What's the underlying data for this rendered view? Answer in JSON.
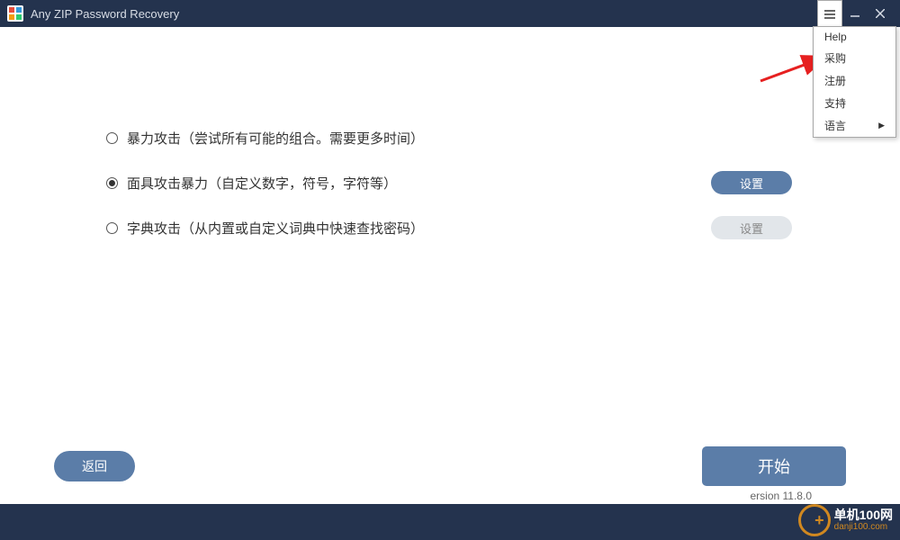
{
  "titlebar": {
    "title": "Any ZIP Password Recovery"
  },
  "menu": {
    "items": [
      {
        "label": "Help",
        "has_submenu": false
      },
      {
        "label": "采购",
        "has_submenu": false
      },
      {
        "label": "注册",
        "has_submenu": false
      },
      {
        "label": "支持",
        "has_submenu": false
      },
      {
        "label": "语言",
        "has_submenu": true
      }
    ]
  },
  "options": {
    "brute": {
      "label": "暴力攻击（尝试所有可能的组合。需要更多时间）",
      "selected": false
    },
    "mask": {
      "label": "面具攻击暴力（自定义数字，符号，字符等）",
      "selected": true,
      "settings_label": "设置"
    },
    "dict": {
      "label": "字典攻击（从内置或自定义词典中快速查找密码）",
      "selected": false,
      "settings_label": "设置"
    }
  },
  "buttons": {
    "back": "返回",
    "start": "开始"
  },
  "version": "ersion 11.8.0",
  "watermark": {
    "line1": "单机100网",
    "line2": "danji100.com"
  }
}
